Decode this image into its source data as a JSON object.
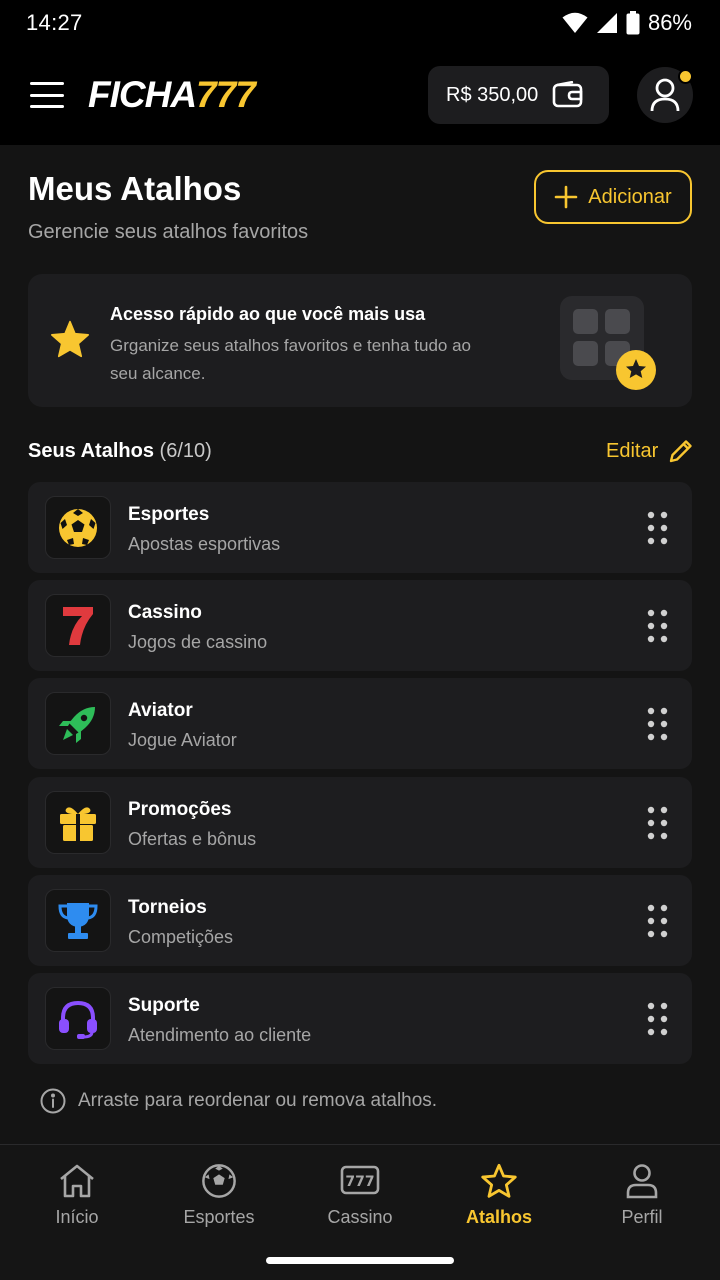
{
  "status_bar": {
    "time": "14:27",
    "battery": "86%"
  },
  "header": {
    "logo_part1": "FICHA",
    "logo_part2": "777",
    "balance": "R$ 350,00"
  },
  "page": {
    "title": "Meus Atalhos",
    "subtitle": "Gerencie seus atalhos favoritos",
    "add_label": "Adicionar"
  },
  "info_card": {
    "title": "Acesso rápido ao que você mais usa",
    "description": "Grganize seus atalhos favoritos e tenha tudo ao seu alcance."
  },
  "section": {
    "title": "Seus Atalhos",
    "count": "(6/10)",
    "edit_label": "Editar"
  },
  "shortcuts": [
    {
      "title": "Esportes",
      "subtitle": "Apostas esportivas",
      "icon": "soccer-ball-icon",
      "color": "#F8C630"
    },
    {
      "title": "Cassino",
      "subtitle": "Jogos de cassino",
      "icon": "seven-icon",
      "color": "#E03A3E"
    },
    {
      "title": "Aviator",
      "subtitle": "Jogue Aviator",
      "icon": "rocket-icon",
      "color": "#2EBD59"
    },
    {
      "title": "Promoções",
      "subtitle": "Ofertas e bônus",
      "icon": "gift-icon",
      "color": "#F8C630"
    },
    {
      "title": "Torneios",
      "subtitle": "Competições",
      "icon": "trophy-icon",
      "color": "#2E8CF0"
    },
    {
      "title": "Suporte",
      "subtitle": "Atendimento ao cliente",
      "icon": "headset-icon",
      "color": "#8A4FFF"
    }
  ],
  "hint": "Arraste para reordenar ou remova atalhos.",
  "nav": {
    "items": [
      {
        "label": "Início",
        "icon": "home-icon"
      },
      {
        "label": "Esportes",
        "icon": "soccer-ball-icon"
      },
      {
        "label": "Cassino",
        "icon": "slot-777-icon"
      },
      {
        "label": "Atalhos",
        "icon": "star-icon",
        "active": true
      },
      {
        "label": "Perfil",
        "icon": "person-icon"
      }
    ]
  },
  "colors": {
    "accent": "#F8C630",
    "background": "#141414",
    "card": "#1D1D1F"
  }
}
